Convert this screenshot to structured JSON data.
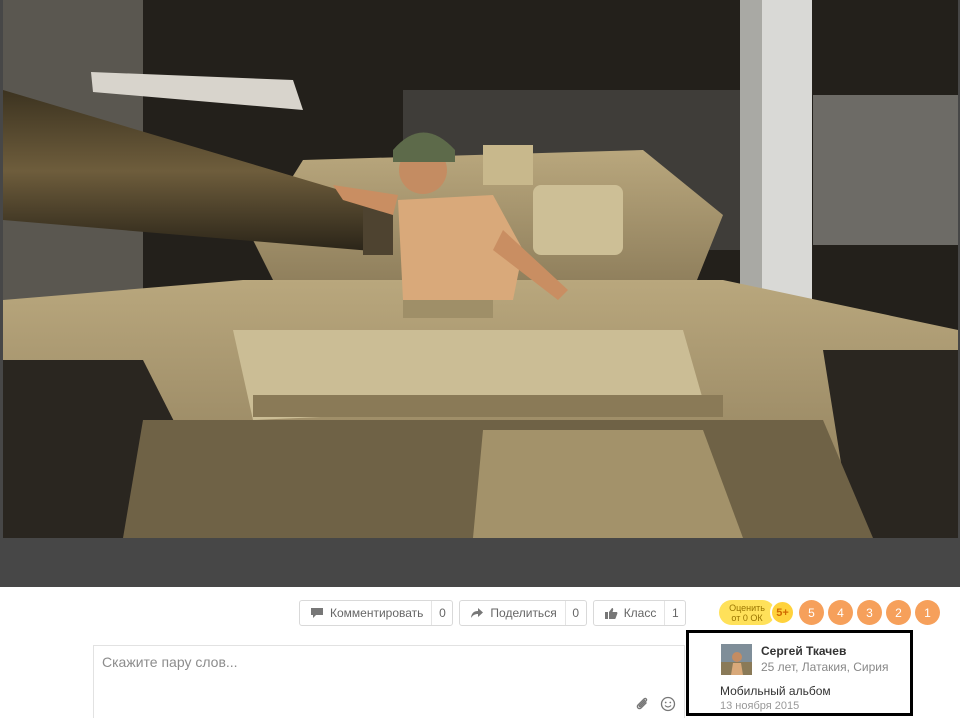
{
  "actions": {
    "comment": {
      "label": "Комментировать",
      "count": "0"
    },
    "share": {
      "label": "Поделиться",
      "count": "0"
    },
    "like": {
      "label": "Класс",
      "count": "1"
    }
  },
  "rating": {
    "label_line1": "Оценить",
    "label_line2": "от 0 ОК",
    "top": "5+",
    "scores": [
      "5",
      "4",
      "3",
      "2",
      "1"
    ]
  },
  "comment": {
    "placeholder": "Скажите пару слов..."
  },
  "author": {
    "name": "Сергей Ткачев",
    "info": "25 лет, Латакия, Сирия",
    "album": "Мобильный альбом",
    "date": "13 ноября 2015"
  },
  "colors": {
    "rating_label": "#ffe15a",
    "rating_top": "#ffd23c",
    "rating_scores": "#f6a05b"
  }
}
